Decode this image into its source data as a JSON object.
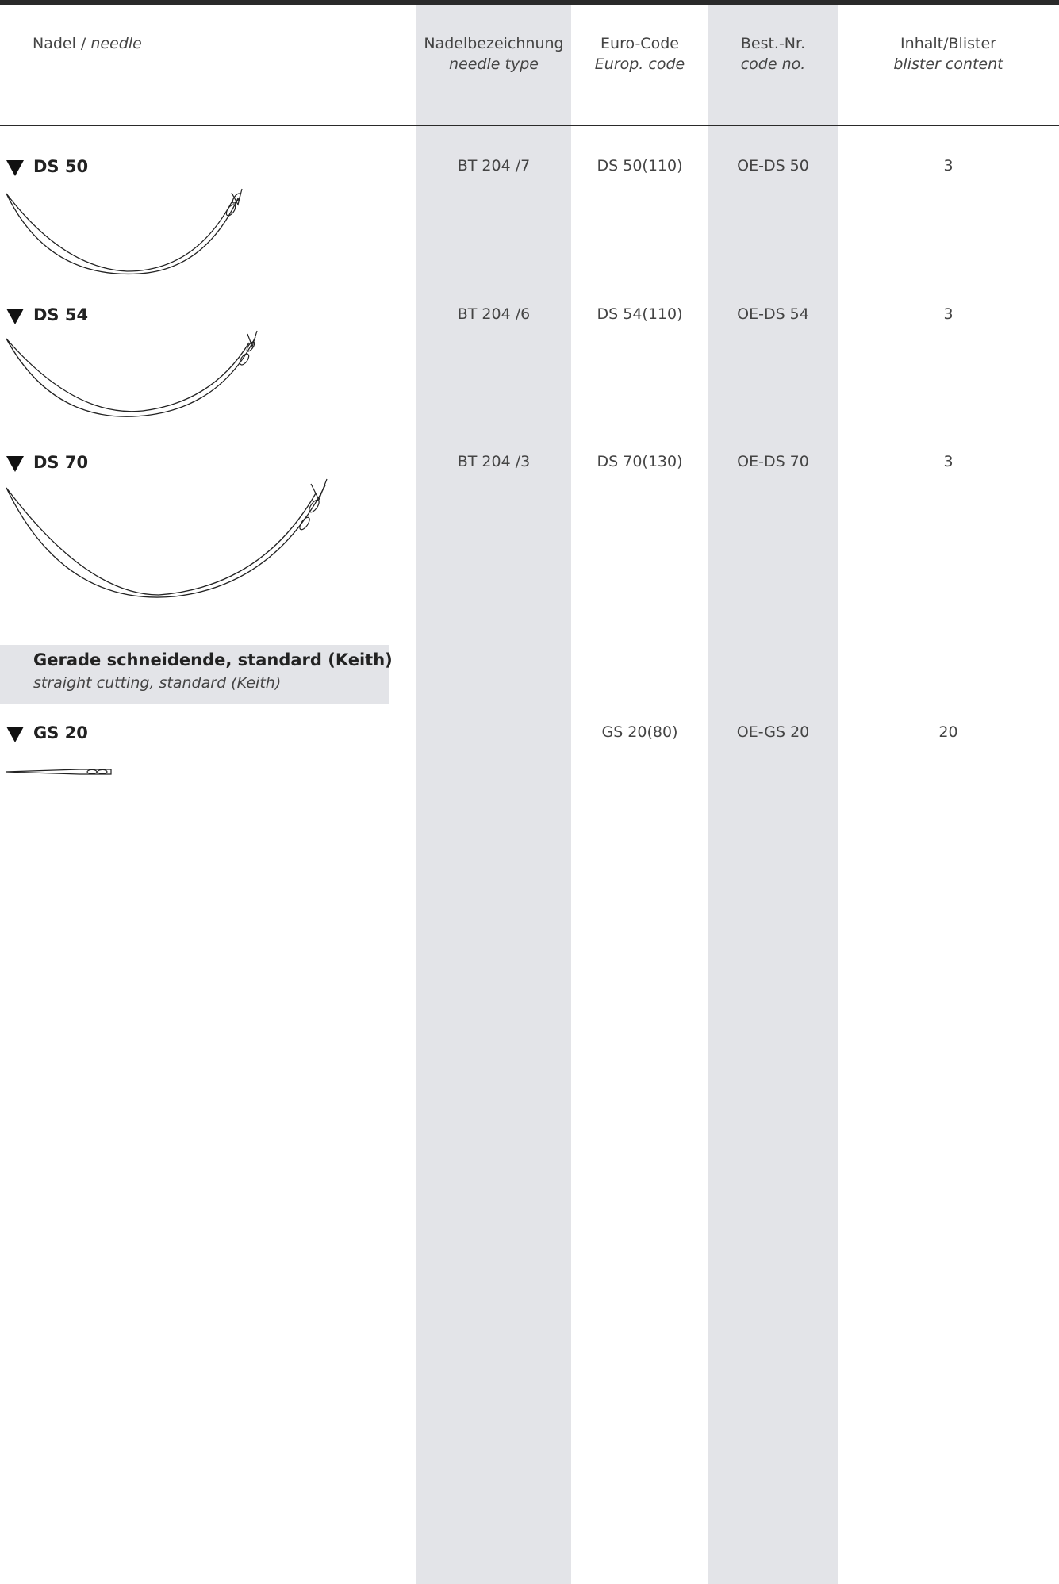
{
  "header": {
    "needle_de": "Nadel / ",
    "needle_en": "needle",
    "type_de": "Nadelbezeichnung",
    "type_en": "needle type",
    "euro_de": "Euro-Code",
    "euro_en": "Europ. code",
    "best_de": "Best.-Nr.",
    "best_en": "code no.",
    "content_de": "Inhalt/Blister",
    "content_en": "blister content"
  },
  "rows": [
    {
      "name": "DS 50",
      "type": "BT 204 /7",
      "euro": "DS 50(110)",
      "best": "OE-DS 50",
      "content": "3"
    },
    {
      "name": "DS 54",
      "type": "BT 204 /6",
      "euro": "DS 54(110)",
      "best": "OE-DS 54",
      "content": "3"
    },
    {
      "name": "DS 70",
      "type": "BT 204 /3",
      "euro": "DS 70(130)",
      "best": "OE-DS 70",
      "content": "3"
    }
  ],
  "section": {
    "title": "Gerade schneidende, standard (Keith)",
    "subtitle": "straight cutting, standard (Keith)"
  },
  "rows2": [
    {
      "name": "GS 20",
      "type": "",
      "euro": "GS 20(80)",
      "best": "OE-GS 20",
      "content": "20"
    }
  ],
  "colors": {
    "column_shade": "#e3e4e8",
    "rule": "#2a2a2a",
    "text": "#444444"
  }
}
